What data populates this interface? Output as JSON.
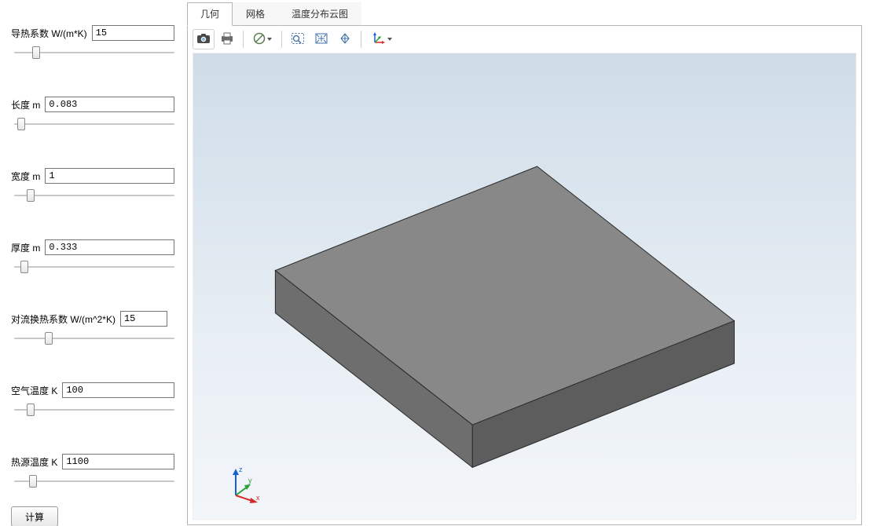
{
  "params": {
    "thermal_conductivity": {
      "label": "导热系数 W/(m*K)",
      "value": "15",
      "slider": 12
    },
    "length": {
      "label": "长度 m",
      "value": "0.083",
      "slider": 2
    },
    "width": {
      "label": "宽度 m",
      "value": "1",
      "slider": 8
    },
    "thickness": {
      "label": "厚度 m",
      "value": "0.333",
      "slider": 4
    },
    "convection": {
      "label": "对流换热系数 W/(m^2*K)",
      "value": "15",
      "slider": 20
    },
    "air_temp": {
      "label": "空气温度 K",
      "value": "100",
      "slider": 8
    },
    "source_temp": {
      "label": "热源温度 K",
      "value": "1100",
      "slider": 10
    }
  },
  "buttons": {
    "compute": "计算"
  },
  "tabs": [
    {
      "id": "geometry",
      "label": "几何",
      "active": true
    },
    {
      "id": "mesh",
      "label": "网格",
      "active": false
    },
    {
      "id": "temp_plot",
      "label": "温度分布云图",
      "active": false
    }
  ],
  "axis_labels": {
    "x": "x",
    "y": "y",
    "z": "z"
  }
}
